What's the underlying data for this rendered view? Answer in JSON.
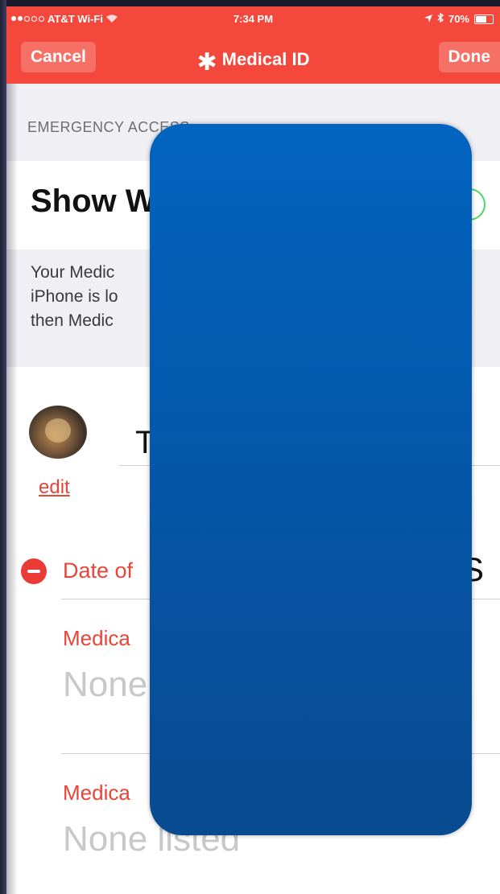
{
  "status_bar": {
    "carrier": "AT&T Wi-Fi",
    "time": "7:34 PM",
    "battery": "70%",
    "battery_level": 0.7
  },
  "nav": {
    "cancel_label": "Cancel",
    "title": "Medical ID",
    "done_label": "Done"
  },
  "emergency": {
    "section_label": "EMERGENCY ACCESS",
    "show_label": "Show W",
    "description": "Your Medic\niPhone is lo\nthen Medic"
  },
  "profile": {
    "edit_label": "edit",
    "name": "T"
  },
  "fields": {
    "dob_label": "Date of",
    "dob_value": "S",
    "conditions_label": "Medica",
    "conditions_value": "None",
    "notes_label": "Medica",
    "notes_value": "None listed"
  },
  "colors": {
    "header": "#f4483c",
    "accent_red": "#e8453a",
    "toggle_green": "#4cd964",
    "overlay_blue": "#0556a8"
  }
}
